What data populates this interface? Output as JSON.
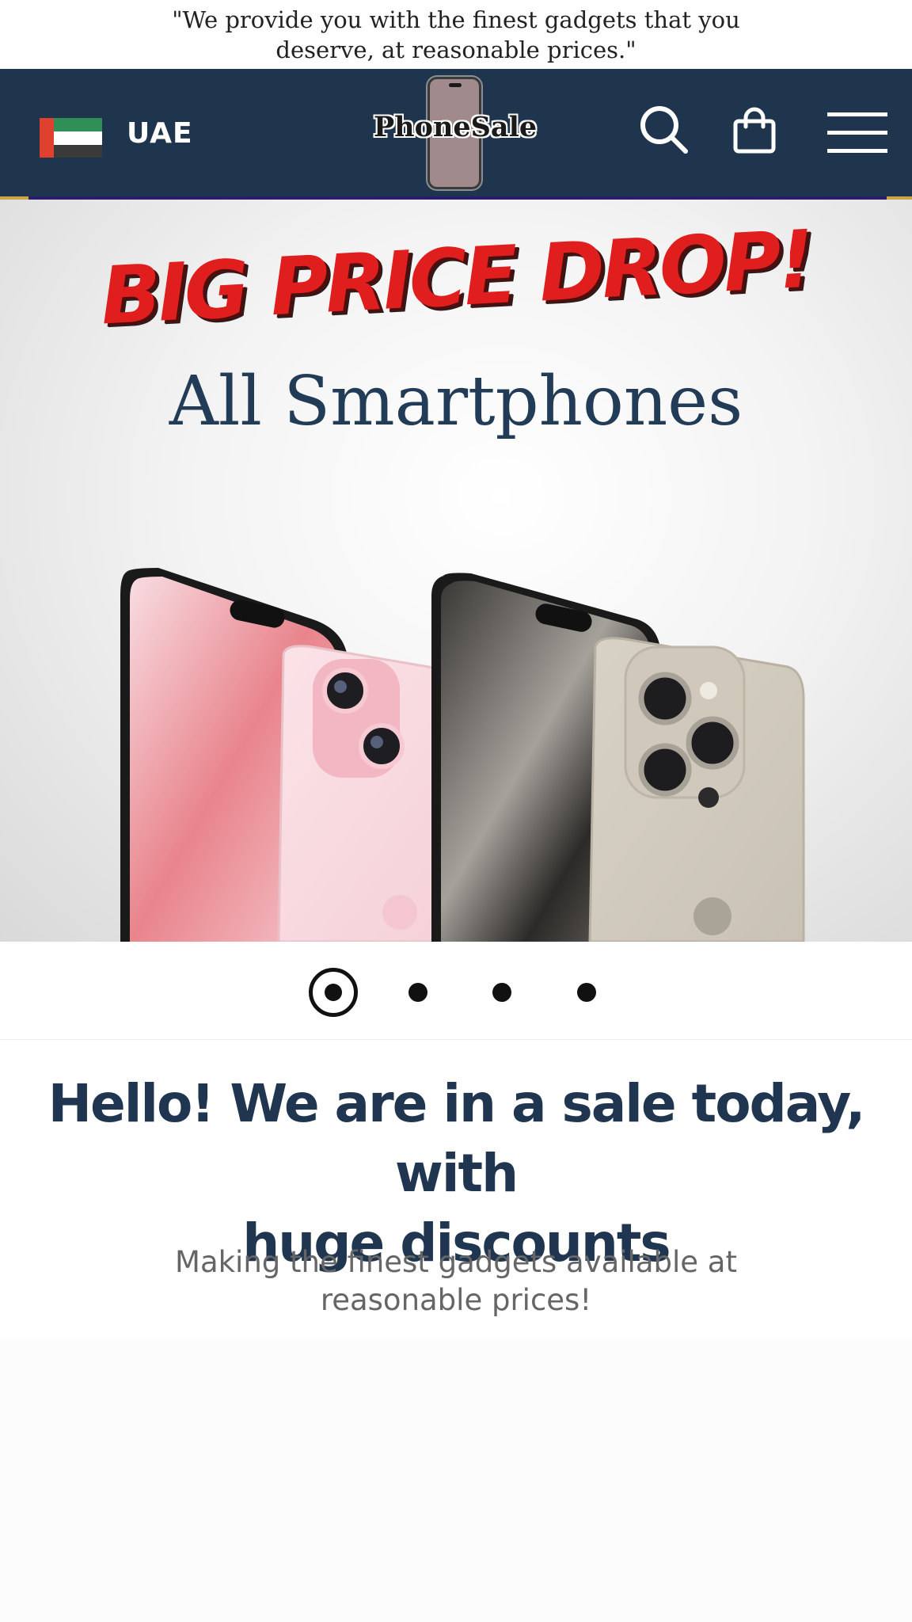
{
  "top_banner": {
    "line1": "\"We provide you with the finest gadgets that you",
    "line2": "deserve, at reasonable prices.\""
  },
  "header": {
    "country": "UAE",
    "logo": "PhoneSale",
    "icons": [
      "search-icon",
      "shopping-bag-icon",
      "hamburger-menu-icon"
    ],
    "background": "#1e354d"
  },
  "hero": {
    "promo": "BIG PRICE DROP!",
    "title": "All Smartphones",
    "promo_color": "#e01e1e",
    "title_color": "#223b57"
  },
  "carousel": {
    "slides": 4,
    "active_index": 0
  },
  "content": {
    "headline_line1": "Hello! We are in a sale today, with",
    "headline_line2": "huge discounts",
    "subtext_line1": "Making the finest gadgets available at",
    "subtext_line2": "reasonable prices!"
  },
  "colors": {
    "brand_navy": "#1e354d",
    "accent_red": "#e01e1e",
    "text_gray": "#666666"
  }
}
